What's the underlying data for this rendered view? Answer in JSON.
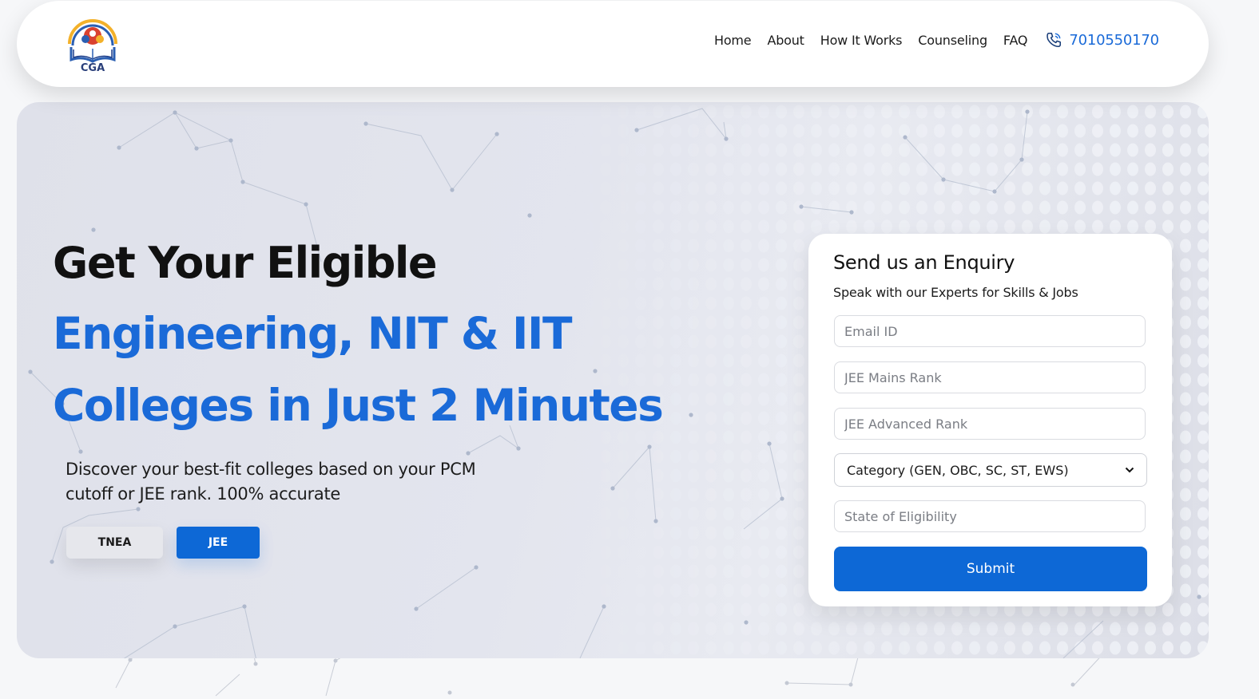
{
  "header": {
    "logo_text": "CGA",
    "nav": [
      "Home",
      "About",
      "How It Works",
      "Counseling",
      "FAQ"
    ],
    "phone": "7010550170"
  },
  "hero": {
    "title_line1": "Get Your Eligible",
    "title_line2": "Engineering, NIT & IIT",
    "title_line3": "Colleges in Just 2 Minutes",
    "description": "Discover your best-fit colleges based on your PCM cutoff or JEE rank. 100% accurate",
    "buttons": {
      "tnea": "TNEA",
      "jee": "JEE"
    }
  },
  "enquiry": {
    "title": "Send us an Enquiry",
    "subtitle": "Speak with our Experts for Skills & Jobs",
    "fields": {
      "email_placeholder": "Email ID",
      "jee_mains_placeholder": "JEE Mains Rank",
      "jee_advanced_placeholder": "JEE Advanced Rank",
      "category_selected": "Category (GEN, OBC, SC, ST, EWS)",
      "state_placeholder": "State of Eligibility"
    },
    "submit_label": "Submit"
  },
  "colors": {
    "accent": "#0d68d6",
    "heading_dark": "#111111",
    "heading_blue": "#1a6ad8",
    "hero_bg": "#e2e4ec"
  },
  "icons": [
    "logo-book-family-icon",
    "phone-icon",
    "chevron-down-icon"
  ]
}
